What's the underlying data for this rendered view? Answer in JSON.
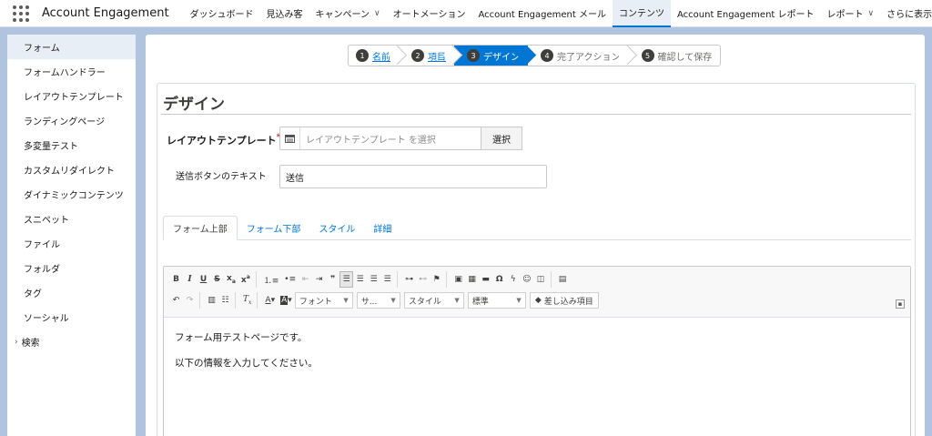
{
  "app": {
    "name": "Account Engagement"
  },
  "nav": {
    "items": [
      {
        "label": "ダッシュボード",
        "chevron": false,
        "active": false
      },
      {
        "label": "見込み客",
        "chevron": false,
        "active": false
      },
      {
        "label": "キャンペーン",
        "chevron": true,
        "active": false
      },
      {
        "label": "オートメーション",
        "chevron": false,
        "active": false
      },
      {
        "label": "Account Engagement メール",
        "chevron": false,
        "active": false
      },
      {
        "label": "コンテンツ",
        "chevron": false,
        "active": true
      },
      {
        "label": "Account Engagement レポート",
        "chevron": false,
        "active": false
      },
      {
        "label": "レポート",
        "chevron": true,
        "active": false
      }
    ],
    "more_label": "さらに表示"
  },
  "sidebar": {
    "items": [
      {
        "label": "フォーム",
        "active": true,
        "caret": false
      },
      {
        "label": "フォームハンドラー",
        "active": false,
        "caret": false
      },
      {
        "label": "レイアウトテンプレート",
        "active": false,
        "caret": false
      },
      {
        "label": "ランディングページ",
        "active": false,
        "caret": false
      },
      {
        "label": "多変量テスト",
        "active": false,
        "caret": false
      },
      {
        "label": "カスタムリダイレクト",
        "active": false,
        "caret": false
      },
      {
        "label": "ダイナミックコンテンツ",
        "active": false,
        "caret": false
      },
      {
        "label": "スニペット",
        "active": false,
        "caret": false
      },
      {
        "label": "ファイル",
        "active": false,
        "caret": false
      },
      {
        "label": "フォルダ",
        "active": false,
        "caret": false
      },
      {
        "label": "タグ",
        "active": false,
        "caret": false
      },
      {
        "label": "ソーシャル",
        "active": false,
        "caret": false
      },
      {
        "label": "検索",
        "active": false,
        "caret": true
      }
    ]
  },
  "steps": [
    {
      "num": "1",
      "label": "名前",
      "state": "done"
    },
    {
      "num": "2",
      "label": "項目",
      "state": "done"
    },
    {
      "num": "3",
      "label": "デザイン",
      "state": "current"
    },
    {
      "num": "4",
      "label": "完了アクション",
      "state": "future"
    },
    {
      "num": "5",
      "label": "確認して保存",
      "state": "future"
    }
  ],
  "design": {
    "title": "デザイン",
    "layout_template_label": "レイアウトテンプレート",
    "required_mark": "*",
    "layout_template_placeholder": "レイアウトテンプレート を選択",
    "select_button": "選択",
    "submit_label": "送信ボタンのテキスト",
    "submit_value": "送信"
  },
  "tabs": [
    {
      "label": "フォーム上部",
      "active": true
    },
    {
      "label": "フォーム下部",
      "active": false
    },
    {
      "label": "スタイル",
      "active": false
    },
    {
      "label": "詳細",
      "active": false
    }
  ],
  "editor": {
    "font_combo": "フォント",
    "size_combo": "サ...",
    "style_combo": "スタイル",
    "format_combo": "標準",
    "merge_field": "差し込み項目",
    "content": [
      "フォーム用テストページです。",
      "以下の情報を入力してください。"
    ]
  }
}
